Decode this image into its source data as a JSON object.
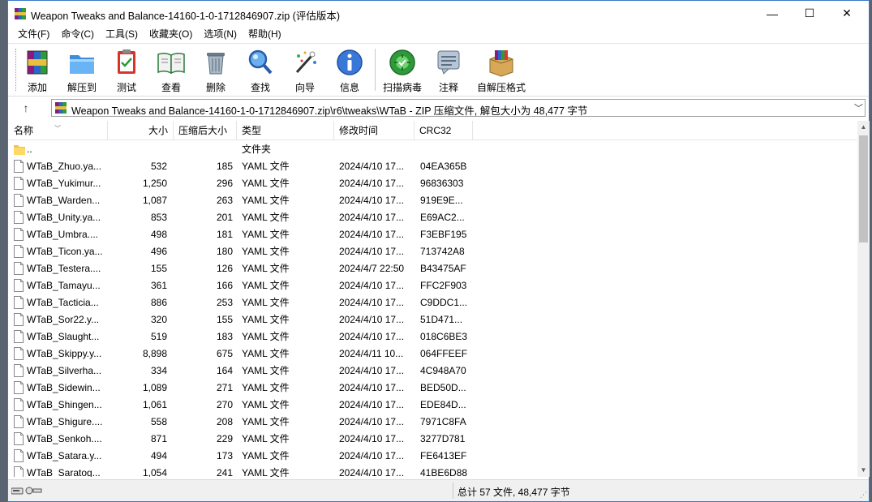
{
  "window": {
    "title": "Weapon Tweaks and Balance-14160-1-0-1712846907.zip (评估版本)",
    "minimize": "—",
    "maximize": "☐",
    "close": "✕"
  },
  "menu": [
    "文件(F)",
    "命令(C)",
    "工具(S)",
    "收藏夹(O)",
    "选项(N)",
    "帮助(H)"
  ],
  "toolbar": {
    "buttons": [
      {
        "label": "添加",
        "icon": "add-archive-icon"
      },
      {
        "label": "解压到",
        "icon": "extract-to-icon"
      },
      {
        "label": "测试",
        "icon": "test-icon"
      },
      {
        "label": "查看",
        "icon": "view-icon"
      },
      {
        "label": "删除",
        "icon": "delete-icon"
      },
      {
        "label": "查找",
        "icon": "find-icon"
      },
      {
        "label": "向导",
        "icon": "wizard-icon"
      },
      {
        "label": "信息",
        "icon": "info-icon"
      },
      {
        "label": "扫描病毒",
        "icon": "virus-scan-icon"
      },
      {
        "label": "注释",
        "icon": "comment-icon"
      },
      {
        "label": "自解压格式",
        "icon": "sfx-icon"
      }
    ]
  },
  "address": {
    "path": "Weapon Tweaks and Balance-14160-1-0-1712846907.zip\\r6\\tweaks\\WTaB - ZIP 压缩文件, 解包大小为 48,477 字节"
  },
  "columns": {
    "name": "名称",
    "size": "大小",
    "packed": "压缩后大小",
    "type": "类型",
    "modified": "修改时间",
    "crc": "CRC32"
  },
  "parent_row": {
    "name": "..",
    "type": "文件夹"
  },
  "files": [
    {
      "name": "WTaB_Zhuo.ya...",
      "size": "532",
      "packed": "185",
      "type": "YAML 文件",
      "modified": "2024/4/10 17...",
      "crc": "04EA365B"
    },
    {
      "name": "WTaB_Yukimur...",
      "size": "1,250",
      "packed": "296",
      "type": "YAML 文件",
      "modified": "2024/4/10 17...",
      "crc": "96836303"
    },
    {
      "name": "WTaB_Warden...",
      "size": "1,087",
      "packed": "263",
      "type": "YAML 文件",
      "modified": "2024/4/10 17...",
      "crc": "919E9E..."
    },
    {
      "name": "WTaB_Unity.ya...",
      "size": "853",
      "packed": "201",
      "type": "YAML 文件",
      "modified": "2024/4/10 17...",
      "crc": "E69AC2..."
    },
    {
      "name": "WTaB_Umbra....",
      "size": "498",
      "packed": "181",
      "type": "YAML 文件",
      "modified": "2024/4/10 17...",
      "crc": "F3EBF195"
    },
    {
      "name": "WTaB_Ticon.ya...",
      "size": "496",
      "packed": "180",
      "type": "YAML 文件",
      "modified": "2024/4/10 17...",
      "crc": "713742A8"
    },
    {
      "name": "WTaB_Testera....",
      "size": "155",
      "packed": "126",
      "type": "YAML 文件",
      "modified": "2024/4/7 22:50",
      "crc": "B43475AF"
    },
    {
      "name": "WTaB_Tamayu...",
      "size": "361",
      "packed": "166",
      "type": "YAML 文件",
      "modified": "2024/4/10 17...",
      "crc": "FFC2F903"
    },
    {
      "name": "WTaB_Tacticia...",
      "size": "886",
      "packed": "253",
      "type": "YAML 文件",
      "modified": "2024/4/10 17...",
      "crc": "C9DDC1..."
    },
    {
      "name": "WTaB_Sor22.y...",
      "size": "320",
      "packed": "155",
      "type": "YAML 文件",
      "modified": "2024/4/10 17...",
      "crc": "51D471..."
    },
    {
      "name": "WTaB_Slaught...",
      "size": "519",
      "packed": "183",
      "type": "YAML 文件",
      "modified": "2024/4/10 17...",
      "crc": "018C6BE3"
    },
    {
      "name": "WTaB_Skippy.y...",
      "size": "8,898",
      "packed": "675",
      "type": "YAML 文件",
      "modified": "2024/4/11 10...",
      "crc": "064FFEEF"
    },
    {
      "name": "WTaB_Silverha...",
      "size": "334",
      "packed": "164",
      "type": "YAML 文件",
      "modified": "2024/4/10 17...",
      "crc": "4C948A70"
    },
    {
      "name": "WTaB_Sidewin...",
      "size": "1,089",
      "packed": "271",
      "type": "YAML 文件",
      "modified": "2024/4/10 17...",
      "crc": "BED50D..."
    },
    {
      "name": "WTaB_Shingen...",
      "size": "1,061",
      "packed": "270",
      "type": "YAML 文件",
      "modified": "2024/4/10 17...",
      "crc": "EDE84D..."
    },
    {
      "name": "WTaB_Shigure....",
      "size": "558",
      "packed": "208",
      "type": "YAML 文件",
      "modified": "2024/4/10 17...",
      "crc": "7971C8FA"
    },
    {
      "name": "WTaB_Senkoh....",
      "size": "871",
      "packed": "229",
      "type": "YAML 文件",
      "modified": "2024/4/10 17...",
      "crc": "3277D781"
    },
    {
      "name": "WTaB_Satara.y...",
      "size": "494",
      "packed": "173",
      "type": "YAML 文件",
      "modified": "2024/4/10 17...",
      "crc": "FE6413EF"
    },
    {
      "name": "WTaB_Saratog...",
      "size": "1,054",
      "packed": "241",
      "type": "YAML 文件",
      "modified": "2024/4/10 17...",
      "crc": "41BE6D88"
    }
  ],
  "status": {
    "summary": "总计 57 文件, 48,477 字节"
  }
}
